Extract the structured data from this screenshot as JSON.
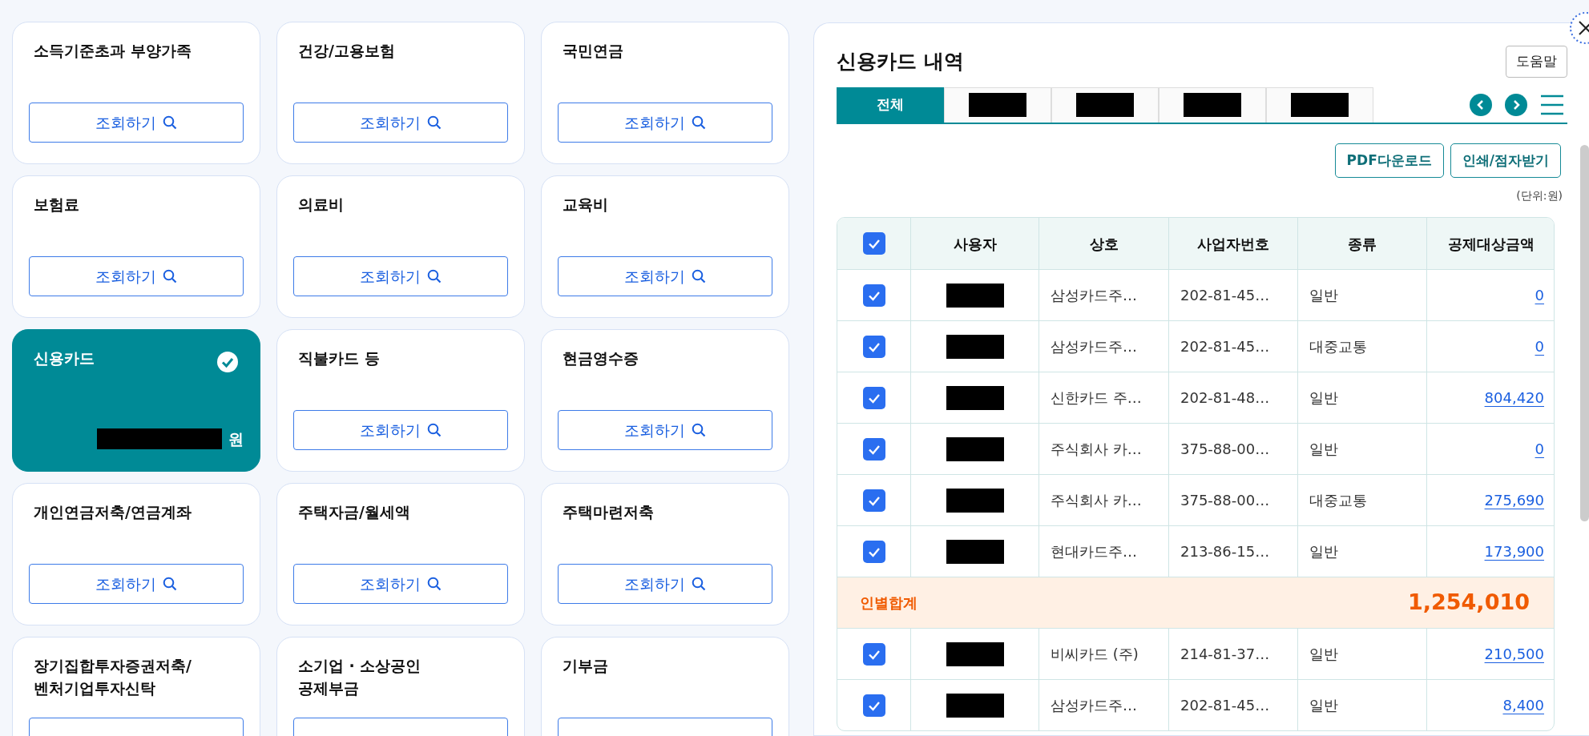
{
  "cards": [
    {
      "title": "소득기준초과 부양가족",
      "kind": "query",
      "button": "조회하기"
    },
    {
      "title": "건강/고용보험",
      "kind": "query",
      "button": "조회하기"
    },
    {
      "title": "국민연금",
      "kind": "query",
      "button": "조회하기"
    },
    {
      "title": "보험료",
      "kind": "query",
      "button": "조회하기"
    },
    {
      "title": "의료비",
      "kind": "query",
      "button": "조회하기"
    },
    {
      "title": "교육비",
      "kind": "query",
      "button": "조회하기"
    },
    {
      "title": "신용카드",
      "kind": "selected",
      "unit": "원"
    },
    {
      "title": "직불카드 등",
      "kind": "query",
      "button": "조회하기"
    },
    {
      "title": "현금영수증",
      "kind": "query",
      "button": "조회하기"
    },
    {
      "title": "개인연금저축/연금계좌",
      "kind": "query",
      "button": "조회하기"
    },
    {
      "title": "주택자금/월세액",
      "kind": "query",
      "button": "조회하기"
    },
    {
      "title": "주택마련저축",
      "kind": "query",
      "button": "조회하기"
    },
    {
      "title": "장기집합투자증권저축/\n벤처기업투자신탁",
      "kind": "query_cut"
    },
    {
      "title": "소기업 · 소상공인\n공제부금",
      "kind": "query_cut"
    },
    {
      "title": "기부금",
      "kind": "query_cut"
    }
  ],
  "panel": {
    "title": "신용카드 내역",
    "help_button": "도움말",
    "tabs": [
      {
        "label": "전체",
        "selected": true
      },
      {
        "selected": false
      },
      {
        "selected": false
      },
      {
        "selected": false
      },
      {
        "selected": false
      }
    ],
    "actions": [
      "PDF다운로드",
      "인쇄/점자받기"
    ],
    "unit_note": "(단위:원)",
    "table": {
      "all_checked": true,
      "columns": [
        "사용자",
        "상호",
        "사업자번호",
        "종류",
        "공제대상금액"
      ],
      "rows": [
        {
          "kind": "item",
          "checked": true,
          "business_name": "삼성카드주…",
          "business_number": "202-81-45…",
          "type": "일반",
          "amount": "0"
        },
        {
          "kind": "item",
          "checked": true,
          "business_name": "삼성카드주…",
          "business_number": "202-81-45…",
          "type": "대중교통",
          "amount": "0"
        },
        {
          "kind": "item",
          "checked": true,
          "business_name": "신한카드 주…",
          "business_number": "202-81-48…",
          "type": "일반",
          "amount": "804,420"
        },
        {
          "kind": "item",
          "checked": true,
          "business_name": "주식회사 카…",
          "business_number": "375-88-00…",
          "type": "일반",
          "amount": "0"
        },
        {
          "kind": "item",
          "checked": true,
          "business_name": "주식회사 카…",
          "business_number": "375-88-00…",
          "type": "대중교통",
          "amount": "275,690"
        },
        {
          "kind": "item",
          "checked": true,
          "business_name": "현대카드주…",
          "business_number": "213-86-15…",
          "type": "일반",
          "amount": "173,900"
        },
        {
          "kind": "subtotal",
          "label": "인별합계",
          "amount": "1,254,010"
        },
        {
          "kind": "item",
          "checked": true,
          "business_name": "비씨카드 (주)",
          "business_number": "214-81-37…",
          "type": "일반",
          "amount": "210,500"
        },
        {
          "kind": "item",
          "checked": true,
          "business_name": "삼성카드주…",
          "business_number": "202-81-45…",
          "type": "일반",
          "amount": "8,400"
        }
      ]
    }
  }
}
